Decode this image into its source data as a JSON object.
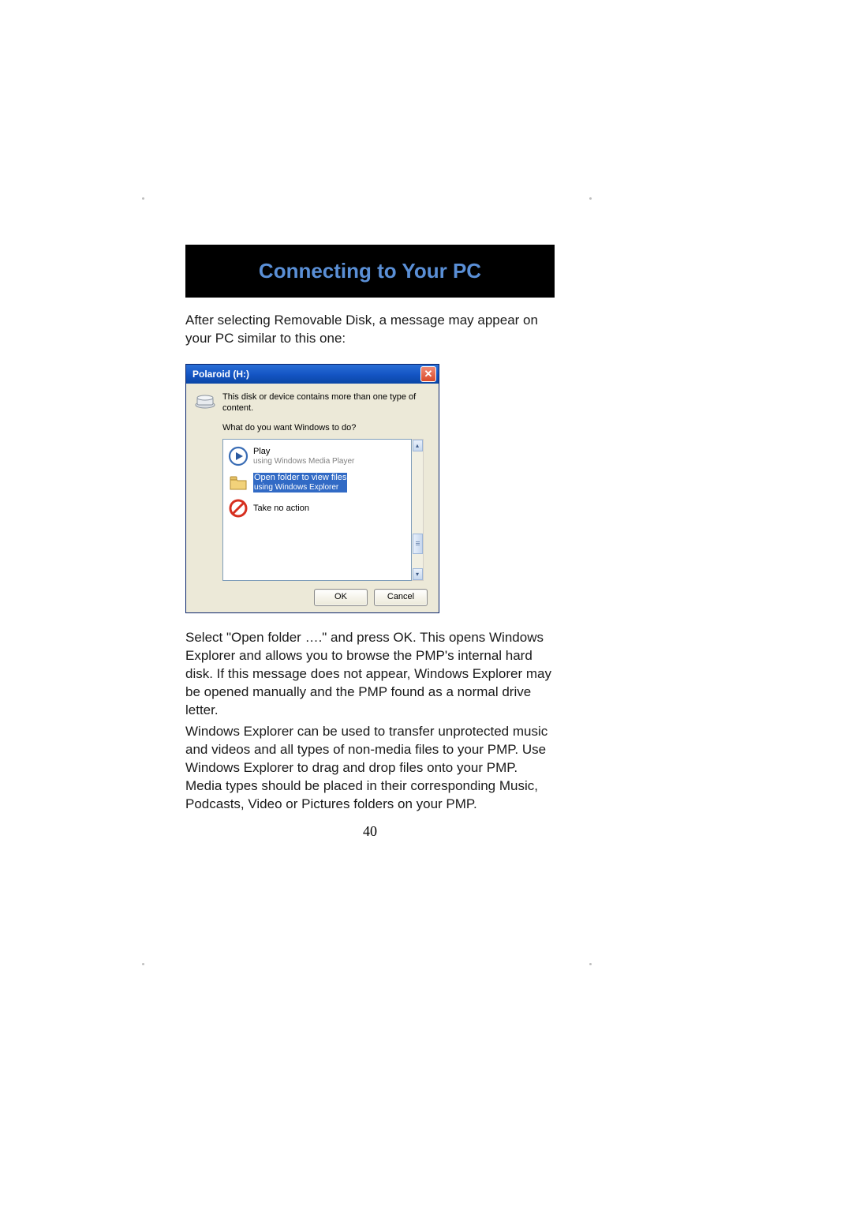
{
  "heading": "Connecting to Your PC",
  "intro": "After selecting Removable Disk, a message may appear on your PC similar to this one:",
  "dialog": {
    "title": "Polaroid (H:)",
    "close_glyph": "✕",
    "message": "This disk or device contains more than one type of content.",
    "prompt": "What do you want Windows to do?",
    "options": [
      {
        "title": "Play",
        "sub": "using Windows Media Player",
        "icon": "play-icon"
      },
      {
        "title": "Open folder to view files",
        "sub": "using Windows Explorer",
        "icon": "folder-icon",
        "selected": true
      },
      {
        "title": "Take no action",
        "sub": "",
        "icon": "no-action-icon"
      }
    ],
    "ok_label": "OK",
    "cancel_label": "Cancel"
  },
  "para1": "Select \"Open folder ….\" and press OK. This opens Windows Explorer and allows you to browse the PMP's internal hard disk. If this message does not appear, Windows Explorer may be opened manually and the PMP found as a normal drive letter.",
  "para2": "Windows Explorer can be used to transfer unprotected music and videos and all types of non-media files to your PMP.  Use Windows Explorer to drag and drop files onto your PMP. Media types should be placed in their corresponding Music, Podcasts, Video or Pictures folders on your PMP.",
  "page_number": "40"
}
